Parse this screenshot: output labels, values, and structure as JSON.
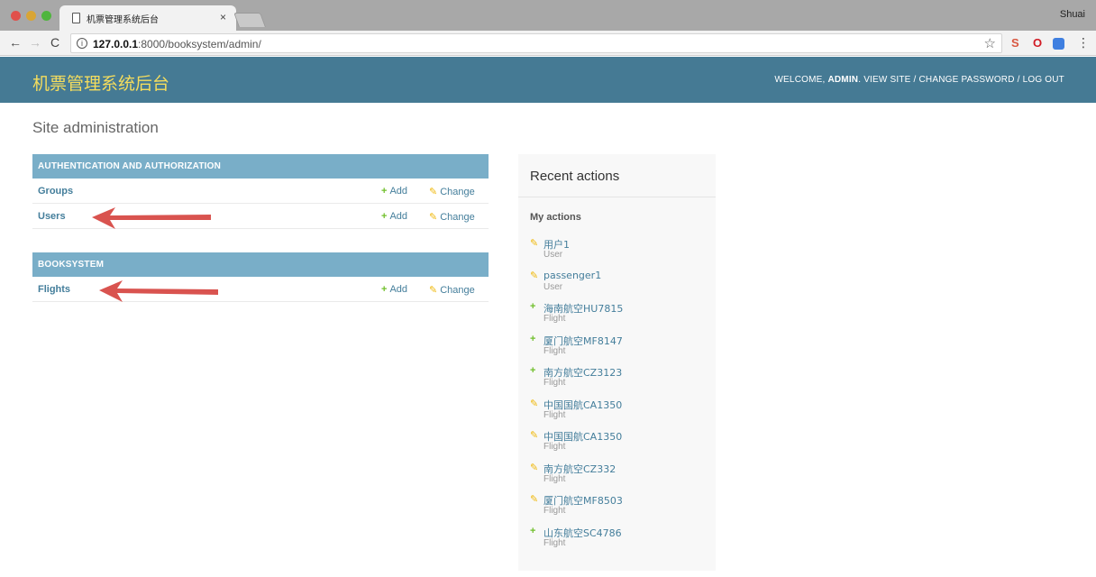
{
  "browser": {
    "tab_title": "机票管理系统后台",
    "tab_close": "×",
    "profile_name": "Shuai",
    "nav": {
      "back": "←",
      "forward": "→",
      "reload": "C"
    },
    "url_host": "127.0.0.1",
    "url_path": ":8000/booksystem/admin/",
    "star": "☆",
    "ext_1": "S",
    "ext_2": "O",
    "menu": "⋮"
  },
  "header": {
    "site_name": "机票管理系统后台",
    "welcome": "WELCOME, ",
    "user": "ADMIN",
    "links": ". VIEW SITE / CHANGE PASSWORD / LOG OUT"
  },
  "content": {
    "title": "Site administration",
    "add_label": "Add",
    "change_label": "Change",
    "modules": [
      {
        "caption": "AUTHENTICATION AND AUTHORIZATION",
        "models": [
          "Groups",
          "Users"
        ]
      },
      {
        "caption": "BOOKSYSTEM",
        "models": [
          "Flights"
        ]
      }
    ]
  },
  "recent": {
    "title": "Recent actions",
    "subtitle": "My actions",
    "items": [
      {
        "icon": "change-icon",
        "name": "用户1",
        "type": "User"
      },
      {
        "icon": "change-icon",
        "name": "passenger1",
        "type": "User"
      },
      {
        "icon": "add-icon",
        "name": "海南航空HU7815",
        "type": "Flight"
      },
      {
        "icon": "add-icon",
        "name": "厦门航空MF8147",
        "type": "Flight"
      },
      {
        "icon": "add-icon",
        "name": "南方航空CZ3123",
        "type": "Flight"
      },
      {
        "icon": "change-icon",
        "name": "中国国航CA1350",
        "type": "Flight"
      },
      {
        "icon": "change-icon",
        "name": "中国国航CA1350",
        "type": "Flight"
      },
      {
        "icon": "change-icon",
        "name": "南方航空CZ332",
        "type": "Flight"
      },
      {
        "icon": "change-icon",
        "name": "厦门航空MF8503",
        "type": "Flight"
      },
      {
        "icon": "add-icon",
        "name": "山东航空SC4786",
        "type": "Flight"
      }
    ]
  },
  "colors": {
    "header_bg": "#457a94",
    "branding": "#f5dd5d",
    "module_caption": "#79aec8",
    "link": "#447e9b",
    "add": "#70bf2b",
    "change": "#efb80b",
    "annotation_arrow": "#d9534f"
  }
}
